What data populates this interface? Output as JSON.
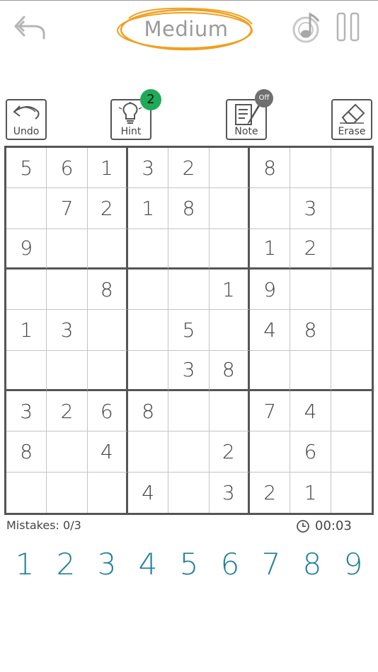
{
  "header": {
    "difficulty": "Medium",
    "accent_color": "#f0a020"
  },
  "toolbar": {
    "undo_label": "Undo",
    "hint_label": "Hint",
    "hint_count": "2",
    "note_label": "Note",
    "note_state": "Off",
    "erase_label": "Erase"
  },
  "board": [
    [
      "5",
      "6",
      "1",
      "3",
      "2",
      "",
      "8",
      "",
      ""
    ],
    [
      "",
      "7",
      "2",
      "1",
      "8",
      "",
      "",
      "3",
      ""
    ],
    [
      "9",
      "",
      "",
      "",
      "",
      "",
      "1",
      "2",
      ""
    ],
    [
      "",
      "",
      "8",
      "",
      "",
      "1",
      "9",
      "",
      ""
    ],
    [
      "1",
      "3",
      "",
      "",
      "5",
      "",
      "4",
      "8",
      ""
    ],
    [
      "",
      "",
      "",
      "",
      "3",
      "8",
      "",
      "",
      ""
    ],
    [
      "3",
      "2",
      "6",
      "8",
      "",
      "",
      "7",
      "4",
      ""
    ],
    [
      "8",
      "",
      "4",
      "",
      "",
      "2",
      "",
      "6",
      ""
    ],
    [
      "",
      "",
      "",
      "4",
      "",
      "3",
      "2",
      "1",
      ""
    ]
  ],
  "status": {
    "mistakes": "Mistakes: 0/3",
    "time": "00:03"
  },
  "numpad": [
    "1",
    "2",
    "3",
    "4",
    "5",
    "6",
    "7",
    "8",
    "9"
  ],
  "numpad_color": "#1d7e9c"
}
